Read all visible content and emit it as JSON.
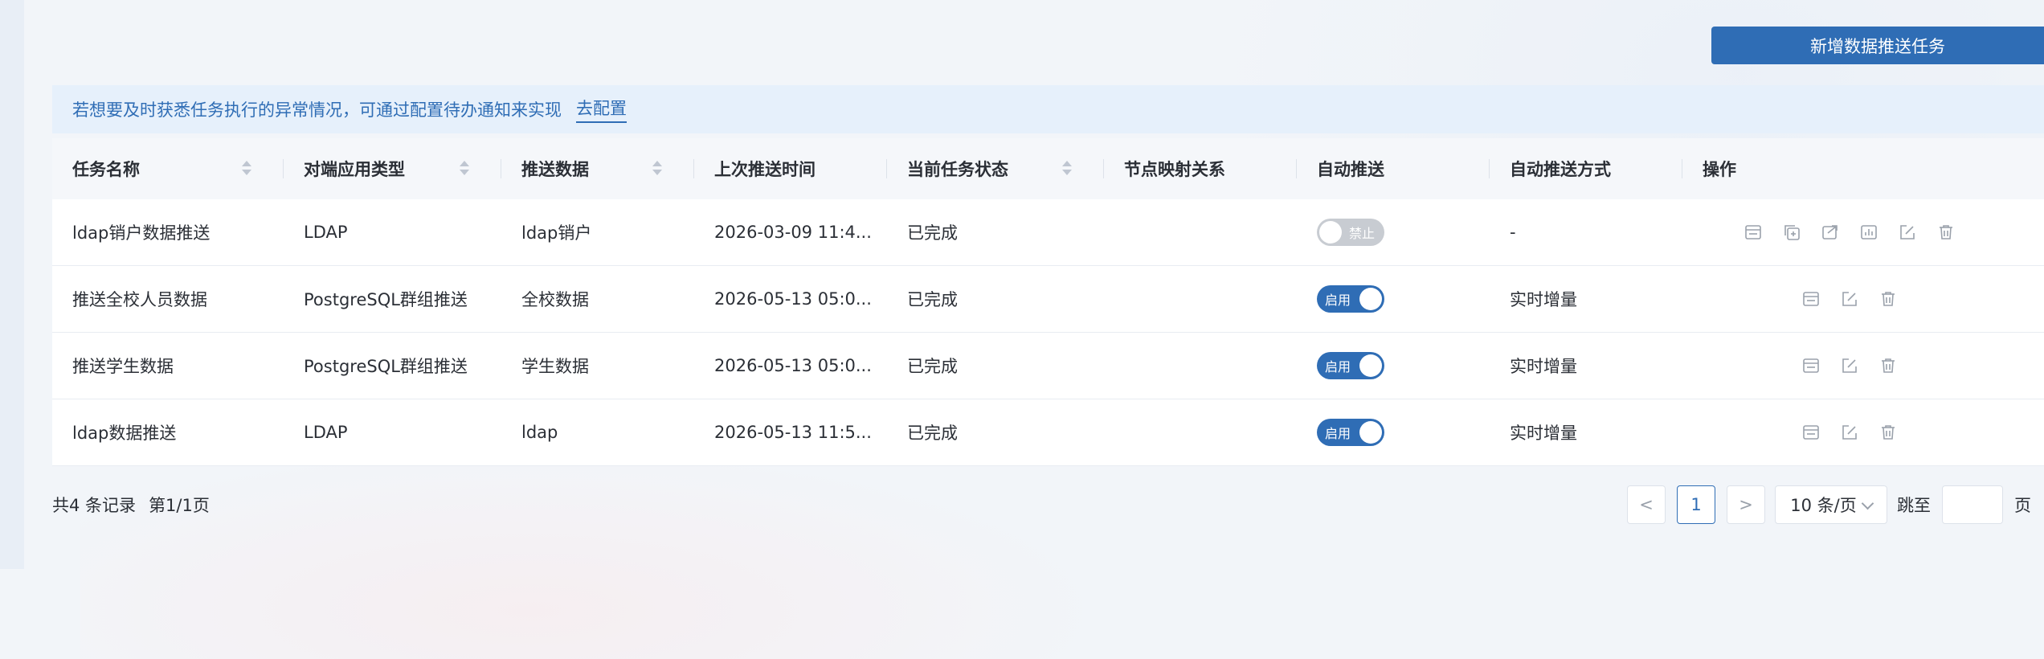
{
  "toolbar": {
    "add_label": "新增数据推送任务"
  },
  "notice": {
    "text": "若想要及时获悉任务执行的异常情况，可通过配置待办通知来实现",
    "link": "去配置"
  },
  "table": {
    "columns": [
      "任务名称",
      "对端应用类型",
      "推送数据",
      "上次推送时间",
      "当前任务状态",
      "节点映射关系",
      "自动推送",
      "自动推送方式",
      "操作"
    ],
    "rows": [
      {
        "name": "ldap销户数据推送",
        "app_type": "LDAP",
        "data": "ldap销户",
        "last_time": "2026-03-09 11:4...",
        "status": "已完成",
        "mapping": "",
        "auto": "禁止",
        "auto_on": false,
        "mode": "-"
      },
      {
        "name": "推送全校人员数据",
        "app_type": "PostgreSQL群组推送",
        "data": "全校数据",
        "last_time": "2026-05-13 05:0...",
        "status": "已完成",
        "mapping": "",
        "auto": "启用",
        "auto_on": true,
        "mode": "实时增量"
      },
      {
        "name": "推送学生数据",
        "app_type": "PostgreSQL群组推送",
        "data": "学生数据",
        "last_time": "2026-05-13 05:0...",
        "status": "已完成",
        "mapping": "",
        "auto": "启用",
        "auto_on": true,
        "mode": "实时增量"
      },
      {
        "name": "ldap数据推送",
        "app_type": "LDAP",
        "data": "ldap",
        "last_time": "2026-05-13 11:5...",
        "status": "已完成",
        "mapping": "",
        "auto": "启用",
        "auto_on": true,
        "mode": "实时增量"
      }
    ]
  },
  "footer": {
    "total": "共4 条记录",
    "page_info": "第1/1页"
  },
  "pager": {
    "prev": "<",
    "current": "1",
    "next": ">",
    "size": "10 条/页",
    "jump_label": "跳至",
    "page_unit": "页"
  },
  "icons": {
    "accent": "#2f6db5",
    "muted": "#9aa1ab"
  }
}
